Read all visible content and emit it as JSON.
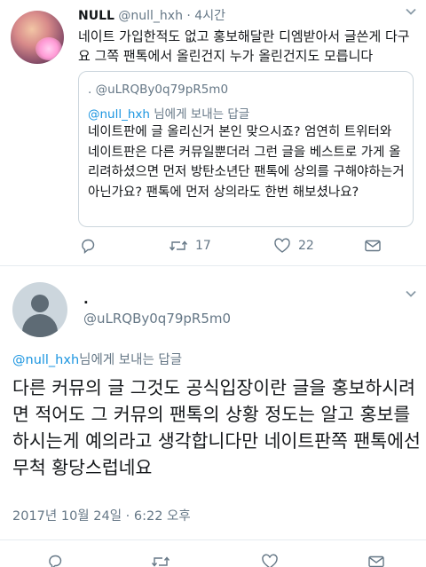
{
  "tweet1": {
    "name": "NULL",
    "handle": "@null_hxh",
    "time": "· 4시간",
    "text": "네이트 가입한적도 없고 홍보해달란 디엠받아서 글쓴게 다구요 그쪽 팬톡에서 올린건지 누가 올린건지도 모릅니다",
    "quote": {
      "handle": ". @uLRQBy0q79pR5m0",
      "reply_to_user": "@null_hxh",
      "reply_to_suffix": " 님에게 보내는 답글",
      "text": "네이트판에 글 올리신거 본인 맞으시죠? 엄연히 트위터와 네이트판은 다른 커뮤일뿐더러 그런 글을 베스트로 가게 올리려하셨으면 먼저 방탄소년단 팬톡에 상의를 구해야하는거아닌가요? 팬톡에 먼저 상의라도 한번 해보셨나요?"
    },
    "actions": {
      "reply_count": "",
      "retweet_count": "17",
      "like_count": "22"
    }
  },
  "tweet2": {
    "name": ".",
    "handle": "@uLRQBy0q79pR5m0",
    "reply_to_user": "@null_hxh",
    "reply_to_suffix": "님에게 보내는 답글",
    "text": "다른 커뮤의 글 그것도 공식입장이란 글을 홍보하시려면 적어도 그 커뮤의 팬톡의 상황 정도는 알고 홍보를 하시는게 예의라고 생각합니다만 네이트판쪽 팬톡에선 무척 황당스럽네요",
    "date": "2017년 10월 24일 · 6:22 오후"
  },
  "icons": [
    "reply-icon",
    "retweet-icon",
    "like-icon",
    "message-icon",
    "chevron-down-icon"
  ],
  "colors": {
    "link": "#1b95e0",
    "secondary_text": "#657786",
    "border": "#ccd6dd",
    "divider": "#e6ecf0"
  }
}
